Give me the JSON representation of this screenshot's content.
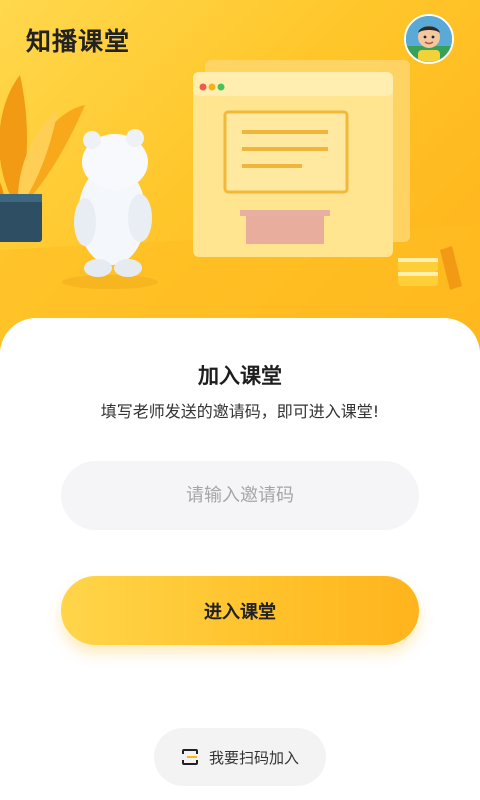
{
  "header": {
    "app_title": "知播课堂",
    "avatar": "child-avatar"
  },
  "join": {
    "title": "加入课堂",
    "subtitle": "填写老师发送的邀请码，即可进入课堂!",
    "code_input": {
      "value": "",
      "placeholder": "请输入邀请码"
    },
    "enter_button": "进入课堂",
    "scan_button": "我要扫码加入"
  },
  "icons": {
    "scan": "scan-code-icon"
  },
  "colors": {
    "brand_yellow": "#ffc62a",
    "button_gradient_start": "#ffd54a",
    "button_gradient_end": "#ffb41c",
    "input_bg": "#f5f4f6",
    "text_dark": "#222222"
  }
}
